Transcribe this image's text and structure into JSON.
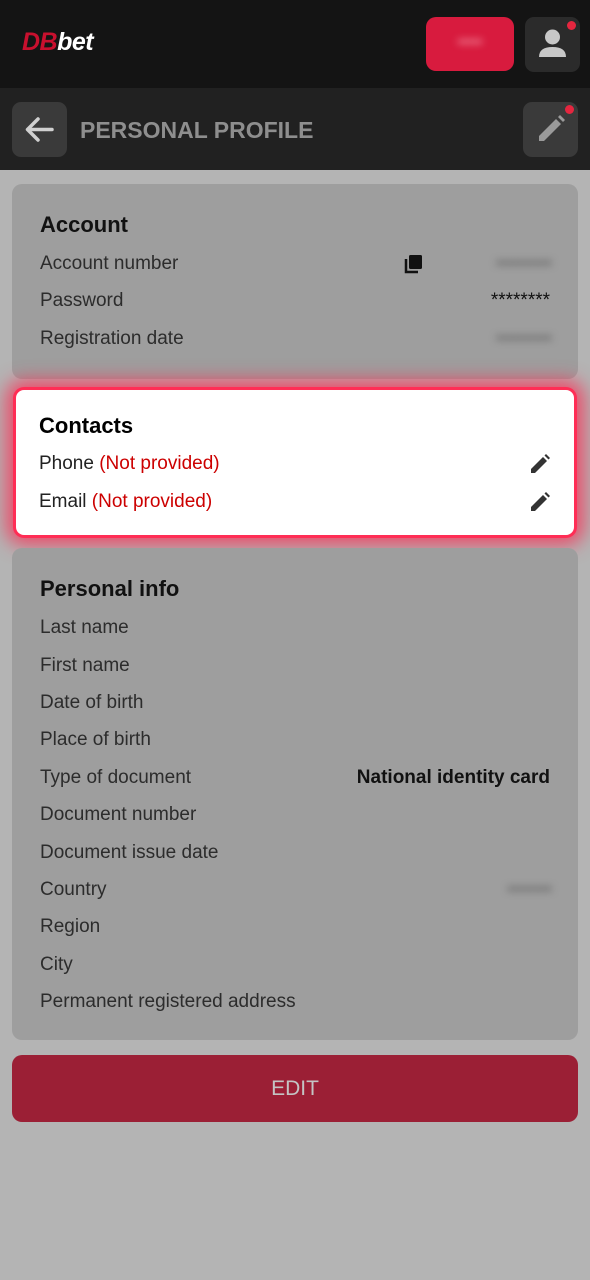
{
  "brand": {
    "logo_part1": "DB",
    "logo_part2": "bet"
  },
  "topbar": {
    "deposit_label": "•••••"
  },
  "header": {
    "title": "PERSONAL PROFILE"
  },
  "account": {
    "title": "Account",
    "rows": [
      {
        "label": "Account number",
        "value": "••••••••••"
      },
      {
        "label": "Password",
        "value": "********"
      },
      {
        "label": "Registration date",
        "value": "••••••••••"
      }
    ]
  },
  "contacts": {
    "title": "Contacts",
    "phone_label": "Phone",
    "phone_status": "(Not provided)",
    "email_label": "Email",
    "email_status": "(Not provided)"
  },
  "personal": {
    "title": "Personal info",
    "rows": [
      {
        "label": "Last name",
        "value": ""
      },
      {
        "label": "First name",
        "value": ""
      },
      {
        "label": "Date of birth",
        "value": ""
      },
      {
        "label": "Place of birth",
        "value": ""
      },
      {
        "label": "Type of document",
        "value": "National identity card"
      },
      {
        "label": "Document number",
        "value": ""
      },
      {
        "label": "Document issue date",
        "value": ""
      },
      {
        "label": "Country",
        "value": "••••••••"
      },
      {
        "label": "Region",
        "value": ""
      },
      {
        "label": "City",
        "value": ""
      },
      {
        "label": "Permanent registered address",
        "value": ""
      }
    ]
  },
  "footer": {
    "edit_label": "EDIT"
  },
  "colors": {
    "accent": "#d81b3e",
    "highlight": "#ff2d55",
    "not_provided": "#cc0000",
    "topbar_bg": "#141414",
    "header_bg": "#212121"
  }
}
